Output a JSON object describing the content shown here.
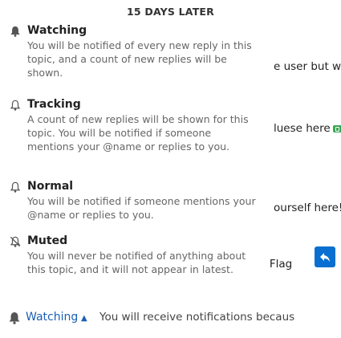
{
  "header": {
    "title": "15 DAYS LATER"
  },
  "background_snippets": [
    "e user but wil",
    "luese here",
    "ourself here!",
    "| Flag"
  ],
  "notification_menu": {
    "items": [
      {
        "title": "Watching",
        "description": "You will be notified of every new reply in this topic, and a count of new replies will be shown.",
        "icon": "bell-filled-icon"
      },
      {
        "title": "Tracking",
        "description": "A count of new replies will be shown for this topic. You will be notified if someone mentions your @name or replies to you.",
        "icon": "bell-outline-icon"
      },
      {
        "title": "Normal",
        "description": "You will be notified if someone mentions your @name or replies to you.",
        "icon": "bell-outline-icon"
      },
      {
        "title": "Muted",
        "description": "You will never be notified of anything about this topic, and it will not appear in latest.",
        "icon": "bell-slash-icon"
      }
    ]
  },
  "footer": {
    "level_label": "Watching",
    "message": "You will receive notifications becaus"
  },
  "colors": {
    "accent": "#0a6fd0",
    "emoji_green": "#3aa655",
    "icon": "#555555"
  }
}
